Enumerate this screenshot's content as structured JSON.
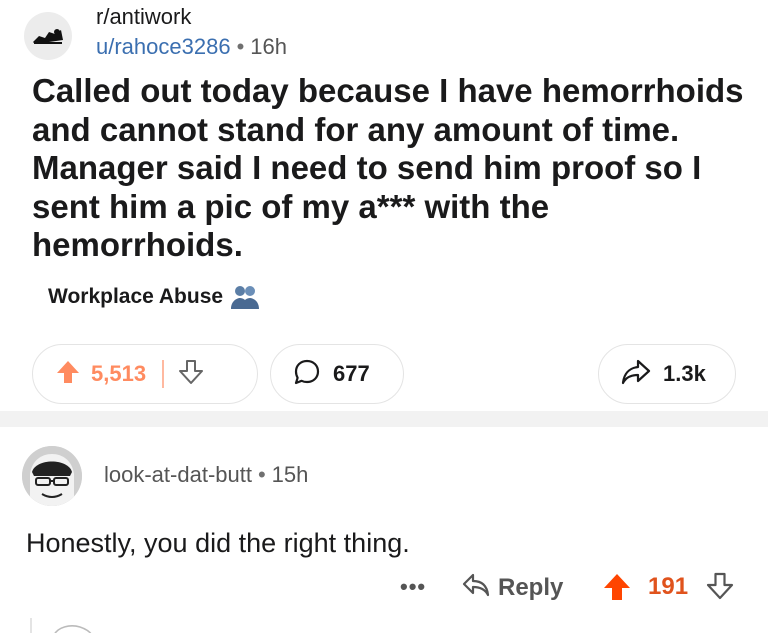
{
  "post": {
    "subreddit": "r/antiwork",
    "author": "u/rahoce3286",
    "separator": "•",
    "time": "16h",
    "title": "Called out today because I have hemorrhoids and cannot stand for any amount of time. Manager said I need to send him proof so I sent him a pic of my a*** with the hemorrhoids.",
    "flair": "Workplace Abuse",
    "votes": "5,513",
    "comments": "677",
    "shares": "1.3k"
  },
  "comment": {
    "author": "look-at-dat-butt",
    "separator": "•",
    "time": "15h",
    "body": "Honestly, you did the right thing.",
    "more": "•••",
    "reply_label": "Reply",
    "score": "191"
  },
  "colors": {
    "upvote_faded": "#ff8b60",
    "upvote_active": "#ff4500",
    "score_active": "#e0531d",
    "author_link": "#3b6fb0"
  },
  "icons": {
    "subreddit": "antiwork-logo-icon",
    "flair": "people-icon",
    "upvote": "arrow-up-icon",
    "downvote": "arrow-down-icon",
    "comment": "speech-bubble-icon",
    "share": "share-arrow-icon",
    "reply": "reply-arrow-icon",
    "more": "more-dots-icon"
  }
}
